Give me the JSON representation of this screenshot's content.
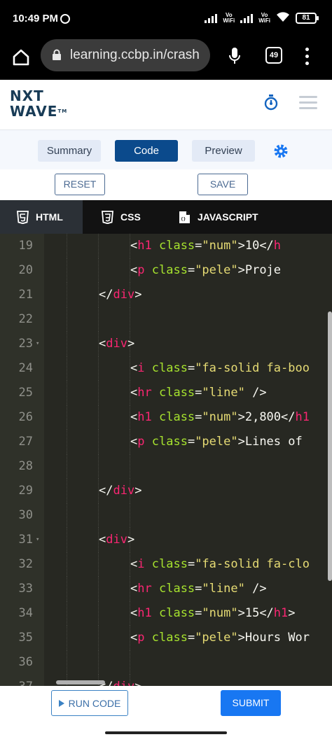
{
  "status_bar": {
    "time": "10:49 PM",
    "network_label_1": "Vo\nWiFi",
    "network_label_2": "Vo\nWiFi",
    "battery": "81",
    "icons": [
      "alarm-icon",
      "signal-icon",
      "wifi-icon",
      "battery-icon"
    ]
  },
  "browser": {
    "url": "learning.ccbp.in/crash",
    "tab_count": "49",
    "icons": [
      "home-icon",
      "lock-icon",
      "mic-icon",
      "tabs-icon",
      "menu-icon"
    ]
  },
  "header": {
    "logo_line1": "NXT",
    "logo_line2": "WAVE",
    "logo_tm": "TM",
    "icons": [
      "timer-icon",
      "hamburger-icon"
    ]
  },
  "view_tabs": {
    "summary": "Summary",
    "code": "Code",
    "preview": "Preview",
    "active": "Code"
  },
  "actions": {
    "reset": "RESET",
    "save": "SAVE"
  },
  "language_tabs": {
    "html": "HTML",
    "css": "CSS",
    "javascript": "JAVASCRIPT",
    "active": "HTML"
  },
  "editor": {
    "lines": [
      {
        "n": "19",
        "indent": 3,
        "tokens": [
          [
            "p",
            "<"
          ],
          [
            "t",
            "h1"
          ],
          [
            "p",
            " "
          ],
          [
            "a",
            "class"
          ],
          [
            "p",
            "="
          ],
          [
            "s",
            "\"num\""
          ],
          [
            "p",
            ">10</"
          ],
          [
            "t",
            "h"
          ]
        ]
      },
      {
        "n": "20",
        "indent": 3,
        "tokens": [
          [
            "p",
            "<"
          ],
          [
            "t",
            "p"
          ],
          [
            "p",
            " "
          ],
          [
            "a",
            "class"
          ],
          [
            "p",
            "="
          ],
          [
            "s",
            "\"pele\""
          ],
          [
            "p",
            ">Proje"
          ]
        ]
      },
      {
        "n": "21",
        "indent": 2,
        "tokens": [
          [
            "p",
            "</"
          ],
          [
            "t",
            "div"
          ],
          [
            "p",
            ">"
          ]
        ]
      },
      {
        "n": "22",
        "indent": 0,
        "tokens": []
      },
      {
        "n": "23",
        "indent": 2,
        "fold": true,
        "tokens": [
          [
            "p",
            "<"
          ],
          [
            "t",
            "div"
          ],
          [
            "p",
            ">"
          ]
        ]
      },
      {
        "n": "24",
        "indent": 3,
        "tokens": [
          [
            "p",
            "<"
          ],
          [
            "t",
            "i"
          ],
          [
            "p",
            " "
          ],
          [
            "a",
            "class"
          ],
          [
            "p",
            "="
          ],
          [
            "s",
            "\"fa-solid fa-boo"
          ]
        ]
      },
      {
        "n": "25",
        "indent": 3,
        "tokens": [
          [
            "p",
            "<"
          ],
          [
            "t",
            "hr"
          ],
          [
            "p",
            " "
          ],
          [
            "a",
            "class"
          ],
          [
            "p",
            "="
          ],
          [
            "s",
            "\"line\""
          ],
          [
            "p",
            " />"
          ]
        ]
      },
      {
        "n": "26",
        "indent": 3,
        "tokens": [
          [
            "p",
            "<"
          ],
          [
            "t",
            "h1"
          ],
          [
            "p",
            " "
          ],
          [
            "a",
            "class"
          ],
          [
            "p",
            "="
          ],
          [
            "s",
            "\"num\""
          ],
          [
            "p",
            ">2,800</"
          ],
          [
            "t",
            "h1"
          ]
        ]
      },
      {
        "n": "27",
        "indent": 3,
        "tokens": [
          [
            "p",
            "<"
          ],
          [
            "t",
            "p"
          ],
          [
            "p",
            " "
          ],
          [
            "a",
            "class"
          ],
          [
            "p",
            "="
          ],
          [
            "s",
            "\"pele\""
          ],
          [
            "p",
            ">Lines of"
          ]
        ]
      },
      {
        "n": "28",
        "indent": 0,
        "tokens": []
      },
      {
        "n": "29",
        "indent": 2,
        "tokens": [
          [
            "p",
            "</"
          ],
          [
            "t",
            "div"
          ],
          [
            "p",
            ">"
          ]
        ]
      },
      {
        "n": "30",
        "indent": 0,
        "tokens": []
      },
      {
        "n": "31",
        "indent": 2,
        "fold": true,
        "tokens": [
          [
            "p",
            "<"
          ],
          [
            "t",
            "div"
          ],
          [
            "p",
            ">"
          ]
        ]
      },
      {
        "n": "32",
        "indent": 3,
        "tokens": [
          [
            "p",
            "<"
          ],
          [
            "t",
            "i"
          ],
          [
            "p",
            " "
          ],
          [
            "a",
            "class"
          ],
          [
            "p",
            "="
          ],
          [
            "s",
            "\"fa-solid fa-clo"
          ]
        ]
      },
      {
        "n": "33",
        "indent": 3,
        "tokens": [
          [
            "p",
            "<"
          ],
          [
            "t",
            "hr"
          ],
          [
            "p",
            " "
          ],
          [
            "a",
            "class"
          ],
          [
            "p",
            "="
          ],
          [
            "s",
            "\"line\""
          ],
          [
            "p",
            " />"
          ]
        ]
      },
      {
        "n": "34",
        "indent": 3,
        "tokens": [
          [
            "p",
            "<"
          ],
          [
            "t",
            "h1"
          ],
          [
            "p",
            " "
          ],
          [
            "a",
            "class"
          ],
          [
            "p",
            "="
          ],
          [
            "s",
            "\"num\""
          ],
          [
            "p",
            ">15</"
          ],
          [
            "t",
            "h1"
          ],
          [
            "p",
            ">"
          ]
        ]
      },
      {
        "n": "35",
        "indent": 3,
        "tokens": [
          [
            "p",
            "<"
          ],
          [
            "t",
            "p"
          ],
          [
            "p",
            " "
          ],
          [
            "a",
            "class"
          ],
          [
            "p",
            "="
          ],
          [
            "s",
            "\"pele\""
          ],
          [
            "p",
            ">Hours Wor"
          ]
        ]
      },
      {
        "n": "36",
        "indent": 0,
        "tokens": []
      },
      {
        "n": "37",
        "indent": 2,
        "tokens": [
          [
            "p",
            "</"
          ],
          [
            "t",
            "div"
          ],
          [
            "p",
            ">"
          ]
        ]
      }
    ]
  },
  "bottom": {
    "run_code": "RUN CODE",
    "submit": "SUBMIT"
  }
}
